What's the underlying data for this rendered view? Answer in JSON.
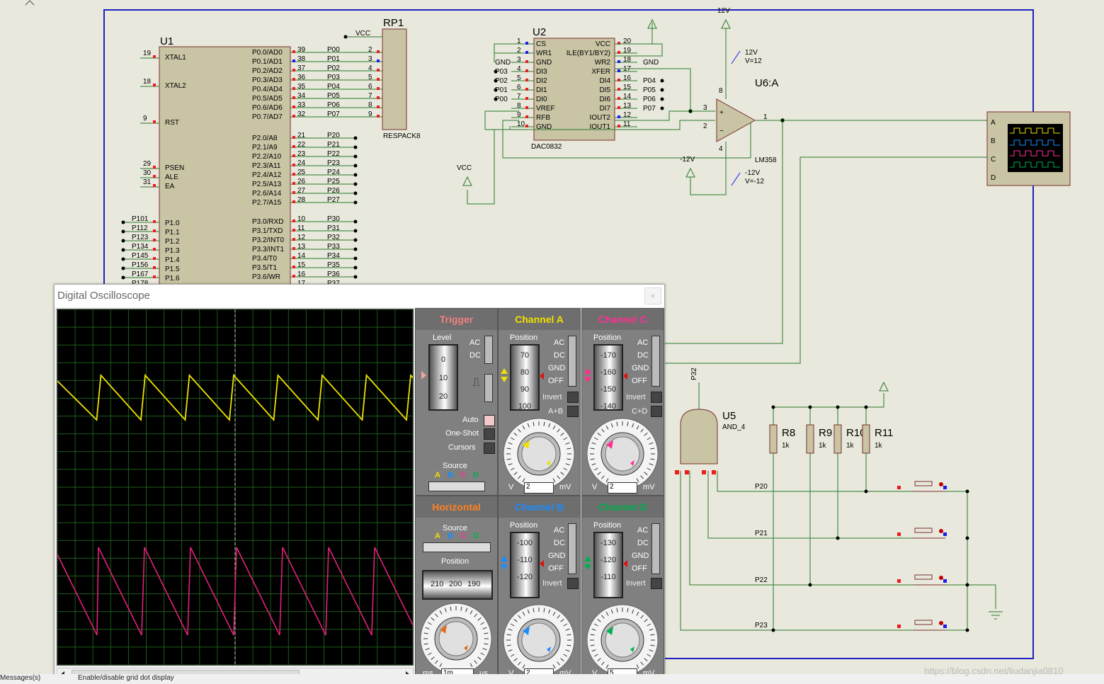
{
  "schematic": {
    "u1": {
      "ref": "U1",
      "left_pins": [
        {
          "num": "19",
          "name": "XTAL1"
        },
        {
          "num": "18",
          "name": "XTAL2"
        },
        {
          "num": "9",
          "name": "RST"
        },
        {
          "num": "29",
          "name": "PSEN"
        },
        {
          "num": "30",
          "name": "ALE"
        },
        {
          "num": "31",
          "name": "EA"
        },
        {
          "num": "",
          "name": "P1.0",
          "net": "P101"
        },
        {
          "num": "",
          "name": "P1.1",
          "net": "P112"
        },
        {
          "num": "",
          "name": "P1.2",
          "net": "P123"
        },
        {
          "num": "",
          "name": "P1.3",
          "net": "P134"
        },
        {
          "num": "",
          "name": "P1.4",
          "net": "P145"
        },
        {
          "num": "",
          "name": "P1.5",
          "net": "P156"
        },
        {
          "num": "",
          "name": "P1.6",
          "net": "P167"
        },
        {
          "num": "",
          "name": "",
          "net": "P178"
        }
      ],
      "p0_pins": [
        {
          "num": "39",
          "name": "P0.0/AD0",
          "net": "P00"
        },
        {
          "num": "38",
          "name": "P0.1/AD1",
          "net": "P01"
        },
        {
          "num": "37",
          "name": "P0.2/AD2",
          "net": "P02"
        },
        {
          "num": "36",
          "name": "P0.3/AD3",
          "net": "P03"
        },
        {
          "num": "35",
          "name": "P0.4/AD4",
          "net": "P04"
        },
        {
          "num": "34",
          "name": "P0.5/AD5",
          "net": "P05"
        },
        {
          "num": "33",
          "name": "P0.6/AD6",
          "net": "P06"
        },
        {
          "num": "32",
          "name": "P0.7/AD7",
          "net": "P07"
        }
      ],
      "p2_pins": [
        {
          "num": "21",
          "name": "P2.0/A8",
          "net": "P20"
        },
        {
          "num": "22",
          "name": "P2.1/A9",
          "net": "P21"
        },
        {
          "num": "23",
          "name": "P2.2/A10",
          "net": "P22"
        },
        {
          "num": "24",
          "name": "P2.3/A11",
          "net": "P23"
        },
        {
          "num": "25",
          "name": "P2.4/A12",
          "net": "P24"
        },
        {
          "num": "26",
          "name": "P2.5/A13",
          "net": "P25"
        },
        {
          "num": "27",
          "name": "P2.6/A14",
          "net": "P26"
        },
        {
          "num": "28",
          "name": "P2.7/A15",
          "net": "P27"
        }
      ],
      "p3_pins": [
        {
          "num": "10",
          "name": "P3.0/RXD",
          "net": "P30"
        },
        {
          "num": "11",
          "name": "P3.1/TXD",
          "net": "P31"
        },
        {
          "num": "12",
          "name": "P3.2/INT0",
          "net": "P32"
        },
        {
          "num": "13",
          "name": "P3.3/INT1",
          "net": "P33"
        },
        {
          "num": "14",
          "name": "P3.4/T0",
          "net": "P34"
        },
        {
          "num": "15",
          "name": "P3.5/T1",
          "net": "P35"
        },
        {
          "num": "16",
          "name": "P3.6/WR",
          "net": "P36"
        },
        {
          "num": "17",
          "name": "",
          "net": "P37"
        }
      ]
    },
    "rp1": {
      "ref": "RP1",
      "type": "RESPACK8",
      "vcc": "VCC",
      "pins": [
        "2",
        "3",
        "4",
        "5",
        "6",
        "7",
        "8",
        "9"
      ]
    },
    "u2": {
      "ref": "U2",
      "type": "DAC0832",
      "left_pins": [
        {
          "num": "1",
          "name": "CS",
          "net": ""
        },
        {
          "num": "2",
          "name": "WR1",
          "net": ""
        },
        {
          "num": "3",
          "name": "GND",
          "net": "GND"
        },
        {
          "num": "4",
          "name": "DI3",
          "net": "P03"
        },
        {
          "num": "5",
          "name": "DI2",
          "net": "P02"
        },
        {
          "num": "6",
          "name": "DI1",
          "net": "P01"
        },
        {
          "num": "7",
          "name": "DI0",
          "net": "P00"
        },
        {
          "num": "8",
          "name": "VREF",
          "net": ""
        },
        {
          "num": "9",
          "name": "RFB",
          "net": ""
        },
        {
          "num": "10",
          "name": "GND",
          "net": ""
        }
      ],
      "right_pins": [
        {
          "num": "20",
          "name": "VCC",
          "net": ""
        },
        {
          "num": "19",
          "name": "ILE(BY1/BY2)",
          "net": ""
        },
        {
          "num": "18",
          "name": "WR2",
          "net": "GND"
        },
        {
          "num": "17",
          "name": "XFER",
          "net": ""
        },
        {
          "num": "16",
          "name": "DI4",
          "net": "P04"
        },
        {
          "num": "15",
          "name": "DI5",
          "net": "P05"
        },
        {
          "num": "14",
          "name": "DI6",
          "net": "P06"
        },
        {
          "num": "13",
          "name": "DI7",
          "net": "P07"
        },
        {
          "num": "12",
          "name": "IOUT2",
          "net": ""
        },
        {
          "num": "11",
          "name": "IOUT1",
          "net": ""
        }
      ]
    },
    "vcc_label": "VCC",
    "u6": {
      "ref": "U6:A",
      "type": "LM358",
      "pin_plus": "3",
      "pin_minus": "2",
      "pin_out": "1",
      "pin_v8": "8",
      "pin_v4": "4"
    },
    "supplies": {
      "pos_net": "12V",
      "pos_label": "12V",
      "pos_value": "V=12",
      "neg_net": "-12V",
      "neg_label": "-12V",
      "neg_value": "V=-12"
    },
    "u5": {
      "ref": "U5",
      "type": "AND_4",
      "net_in": "P32"
    },
    "resistors": [
      {
        "ref": "R8",
        "value": "1k"
      },
      {
        "ref": "R9",
        "value": "1k"
      },
      {
        "ref": "R10",
        "value": "1k"
      },
      {
        "ref": "R11",
        "value": "1k"
      }
    ],
    "button_nets": [
      "P20",
      "P21",
      "P22",
      "P23"
    ],
    "scope_channels": [
      "A",
      "B",
      "C",
      "D"
    ]
  },
  "oscilloscope": {
    "title": "Digital Oscilloscope",
    "close": "×",
    "trigger": {
      "header": "Trigger",
      "level_label": "Level",
      "drum": [
        "0",
        "10",
        "20"
      ],
      "coupling": [
        "AC",
        "DC"
      ],
      "auto_label": "Auto",
      "oneshot_label": "One-Shot",
      "cursors_label": "Cursors",
      "source_label": "Source",
      "sources": [
        "A",
        "B",
        "C",
        "D"
      ]
    },
    "horizontal": {
      "header": "Horizontal",
      "source_label": "Source",
      "sources": [
        "A",
        "B",
        "C",
        "D"
      ],
      "position_label": "Position",
      "position_values": [
        "210",
        "200",
        "190"
      ],
      "dial_ticks": [
        "0.5",
        "0.2",
        "1",
        "2",
        "5",
        "10",
        "20",
        "50",
        "100",
        "200",
        "0.1",
        "0.2",
        "0.5",
        "1",
        "2",
        "5",
        "10",
        "20"
      ],
      "unit_left": "ms",
      "value": "1m",
      "unit_right": "µs"
    },
    "channels": [
      {
        "id": "A",
        "header": "Channel A",
        "color": "#f0e000",
        "position_label": "Position",
        "drum": [
          "70",
          "80",
          "90",
          "100"
        ],
        "coupling": [
          "AC",
          "DC",
          "GND",
          "OFF"
        ],
        "invert_label": "Invert",
        "extra_label": "A+B",
        "unit_left": "V",
        "value": "2",
        "unit_right": "mV",
        "dial_ticks": [
          "0.5",
          "0.2",
          "0.1",
          "50",
          "20",
          "10",
          "5",
          "2",
          "20",
          "10",
          "5",
          "2",
          "1"
        ]
      },
      {
        "id": "C",
        "header": "Channel C",
        "color": "#ff3090",
        "position_label": "Position",
        "drum": [
          "-170",
          "-160",
          "-150",
          "-140"
        ],
        "coupling": [
          "AC",
          "DC",
          "GND",
          "OFF"
        ],
        "invert_label": "Invert",
        "extra_label": "C+D",
        "unit_left": "V",
        "value": "2",
        "unit_right": "mV",
        "dial_ticks": [
          "0.5",
          "0.2",
          "0.1",
          "50",
          "20",
          "10",
          "5",
          "2",
          "20",
          "10",
          "5",
          "2",
          "1"
        ]
      },
      {
        "id": "B",
        "header": "Channel B",
        "color": "#1a8cff",
        "position_label": "Position",
        "drum": [
          "-100",
          "-110",
          "-120"
        ],
        "coupling": [
          "AC",
          "DC",
          "GND",
          "OFF"
        ],
        "invert_label": "Invert",
        "extra_label": "",
        "unit_left": "V",
        "value": "2",
        "unit_right": "mV",
        "dial_ticks": [
          "0.5",
          "0.2",
          "0.1",
          "50",
          "20",
          "10",
          "5",
          "2",
          "20",
          "10",
          "5",
          "2",
          "1"
        ]
      },
      {
        "id": "D",
        "header": "Channel D",
        "color": "#00b050",
        "position_label": "Position",
        "drum": [
          "-130",
          "-120",
          "-110"
        ],
        "coupling": [
          "AC",
          "DC",
          "GND",
          "OFF"
        ],
        "invert_label": "Invert",
        "extra_label": "",
        "unit_left": "V",
        "value": "5",
        "unit_right": "mV",
        "dial_ticks": [
          "0.5",
          "0.2",
          "0.1",
          "50",
          "20",
          "10",
          "5",
          "2",
          "20",
          "10",
          "5",
          "2",
          "1"
        ]
      }
    ]
  },
  "status_bar": {
    "messages": "Messages(s)",
    "hint": "Enable/disable grid dot display"
  },
  "watermark": "https://blog.csdn.net/liudanjia0810",
  "colors": {
    "trace_a": "#f0e000",
    "trace_c": "#e0207a",
    "grid": "#1c5c1c",
    "wire": "#2a7a2a",
    "body": "#c8c4a4",
    "pin_red": "#ee1c1c",
    "pin_blue": "#1c1cee"
  }
}
